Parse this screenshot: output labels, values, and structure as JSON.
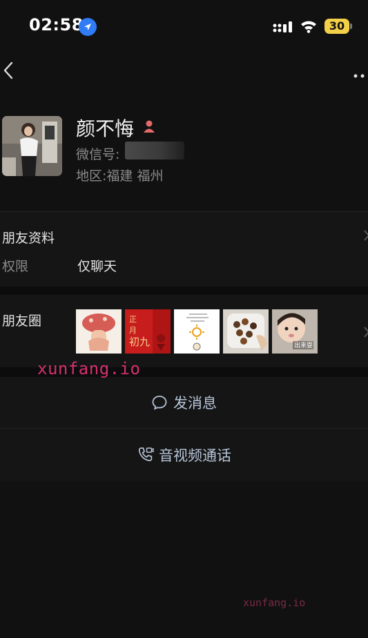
{
  "status_bar": {
    "time": "02:58",
    "battery": "30"
  },
  "profile": {
    "name": "颜不悔",
    "wechat_id_label": "微信号:",
    "region": "地区:福建 福州"
  },
  "friend_info": {
    "title": "朋友资料",
    "permission_label": "权限",
    "permission_value": "仅聊天"
  },
  "moments": {
    "title": "朋友圈",
    "thumbnails": [
      {
        "name": "cartoon-mushroom-photo"
      },
      {
        "name": "red-new-year-card-photo",
        "text": "正月初九"
      },
      {
        "name": "sun-doodle-photo"
      },
      {
        "name": "snack-bowl-photo"
      },
      {
        "name": "baby-photo",
        "text": "出来耍"
      }
    ]
  },
  "actions": {
    "message_label": "发消息",
    "call_label": "音视频通话"
  },
  "watermarks": [
    "xunfang.io",
    "xunfang.io"
  ],
  "colors": {
    "background": "#111111",
    "action_text": "#b7c4d8",
    "location_blue": "#2f7cf6",
    "battery_yellow": "#f3d048",
    "watermark": "#d6306f"
  }
}
